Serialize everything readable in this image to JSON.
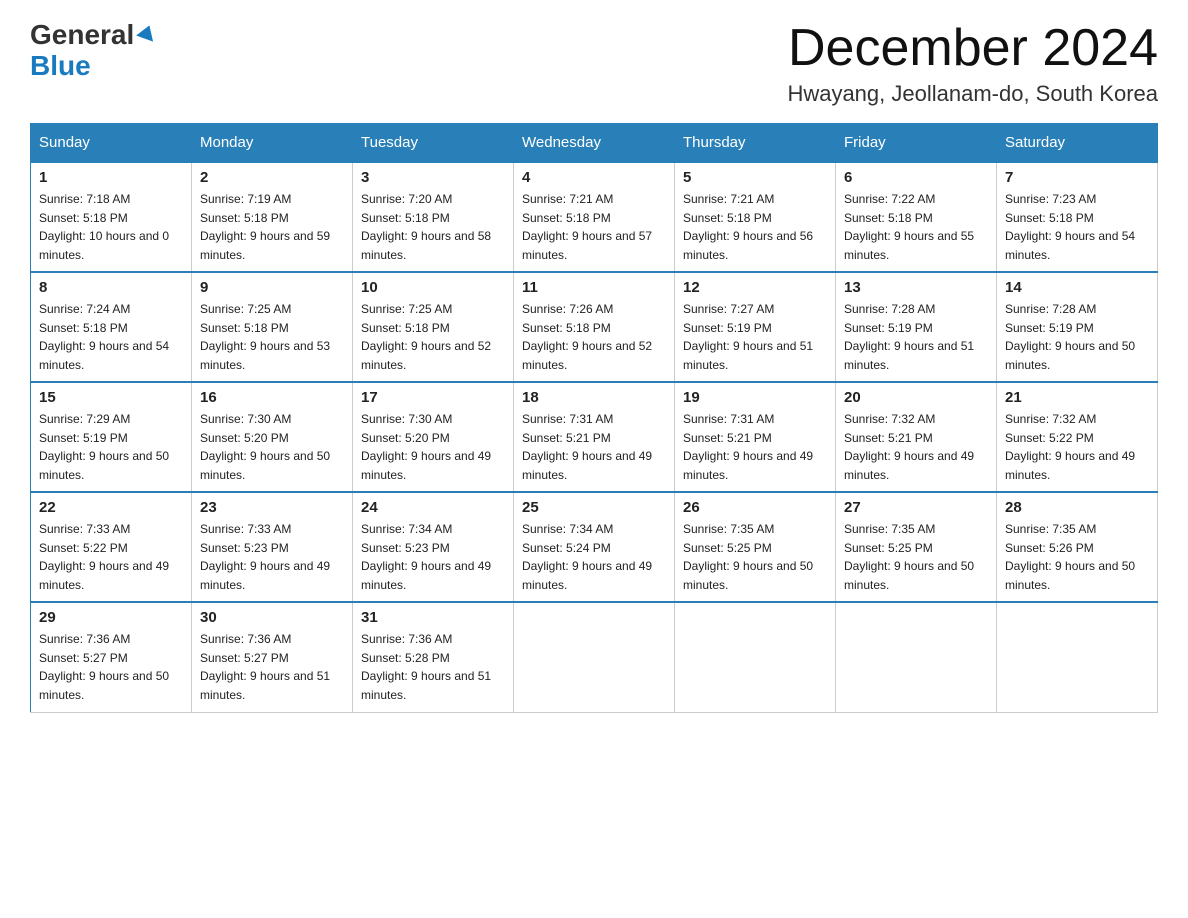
{
  "header": {
    "logo_general": "General",
    "logo_blue": "Blue",
    "month_title": "December 2024",
    "location": "Hwayang, Jeollanam-do, South Korea"
  },
  "weekdays": [
    "Sunday",
    "Monday",
    "Tuesday",
    "Wednesday",
    "Thursday",
    "Friday",
    "Saturday"
  ],
  "weeks": [
    [
      {
        "day": "1",
        "sunrise": "7:18 AM",
        "sunset": "5:18 PM",
        "daylight": "10 hours and 0 minutes."
      },
      {
        "day": "2",
        "sunrise": "7:19 AM",
        "sunset": "5:18 PM",
        "daylight": "9 hours and 59 minutes."
      },
      {
        "day": "3",
        "sunrise": "7:20 AM",
        "sunset": "5:18 PM",
        "daylight": "9 hours and 58 minutes."
      },
      {
        "day": "4",
        "sunrise": "7:21 AM",
        "sunset": "5:18 PM",
        "daylight": "9 hours and 57 minutes."
      },
      {
        "day": "5",
        "sunrise": "7:21 AM",
        "sunset": "5:18 PM",
        "daylight": "9 hours and 56 minutes."
      },
      {
        "day": "6",
        "sunrise": "7:22 AM",
        "sunset": "5:18 PM",
        "daylight": "9 hours and 55 minutes."
      },
      {
        "day": "7",
        "sunrise": "7:23 AM",
        "sunset": "5:18 PM",
        "daylight": "9 hours and 54 minutes."
      }
    ],
    [
      {
        "day": "8",
        "sunrise": "7:24 AM",
        "sunset": "5:18 PM",
        "daylight": "9 hours and 54 minutes."
      },
      {
        "day": "9",
        "sunrise": "7:25 AM",
        "sunset": "5:18 PM",
        "daylight": "9 hours and 53 minutes."
      },
      {
        "day": "10",
        "sunrise": "7:25 AM",
        "sunset": "5:18 PM",
        "daylight": "9 hours and 52 minutes."
      },
      {
        "day": "11",
        "sunrise": "7:26 AM",
        "sunset": "5:18 PM",
        "daylight": "9 hours and 52 minutes."
      },
      {
        "day": "12",
        "sunrise": "7:27 AM",
        "sunset": "5:19 PM",
        "daylight": "9 hours and 51 minutes."
      },
      {
        "day": "13",
        "sunrise": "7:28 AM",
        "sunset": "5:19 PM",
        "daylight": "9 hours and 51 minutes."
      },
      {
        "day": "14",
        "sunrise": "7:28 AM",
        "sunset": "5:19 PM",
        "daylight": "9 hours and 50 minutes."
      }
    ],
    [
      {
        "day": "15",
        "sunrise": "7:29 AM",
        "sunset": "5:19 PM",
        "daylight": "9 hours and 50 minutes."
      },
      {
        "day": "16",
        "sunrise": "7:30 AM",
        "sunset": "5:20 PM",
        "daylight": "9 hours and 50 minutes."
      },
      {
        "day": "17",
        "sunrise": "7:30 AM",
        "sunset": "5:20 PM",
        "daylight": "9 hours and 49 minutes."
      },
      {
        "day": "18",
        "sunrise": "7:31 AM",
        "sunset": "5:21 PM",
        "daylight": "9 hours and 49 minutes."
      },
      {
        "day": "19",
        "sunrise": "7:31 AM",
        "sunset": "5:21 PM",
        "daylight": "9 hours and 49 minutes."
      },
      {
        "day": "20",
        "sunrise": "7:32 AM",
        "sunset": "5:21 PM",
        "daylight": "9 hours and 49 minutes."
      },
      {
        "day": "21",
        "sunrise": "7:32 AM",
        "sunset": "5:22 PM",
        "daylight": "9 hours and 49 minutes."
      }
    ],
    [
      {
        "day": "22",
        "sunrise": "7:33 AM",
        "sunset": "5:22 PM",
        "daylight": "9 hours and 49 minutes."
      },
      {
        "day": "23",
        "sunrise": "7:33 AM",
        "sunset": "5:23 PM",
        "daylight": "9 hours and 49 minutes."
      },
      {
        "day": "24",
        "sunrise": "7:34 AM",
        "sunset": "5:23 PM",
        "daylight": "9 hours and 49 minutes."
      },
      {
        "day": "25",
        "sunrise": "7:34 AM",
        "sunset": "5:24 PM",
        "daylight": "9 hours and 49 minutes."
      },
      {
        "day": "26",
        "sunrise": "7:35 AM",
        "sunset": "5:25 PM",
        "daylight": "9 hours and 50 minutes."
      },
      {
        "day": "27",
        "sunrise": "7:35 AM",
        "sunset": "5:25 PM",
        "daylight": "9 hours and 50 minutes."
      },
      {
        "day": "28",
        "sunrise": "7:35 AM",
        "sunset": "5:26 PM",
        "daylight": "9 hours and 50 minutes."
      }
    ],
    [
      {
        "day": "29",
        "sunrise": "7:36 AM",
        "sunset": "5:27 PM",
        "daylight": "9 hours and 50 minutes."
      },
      {
        "day": "30",
        "sunrise": "7:36 AM",
        "sunset": "5:27 PM",
        "daylight": "9 hours and 51 minutes."
      },
      {
        "day": "31",
        "sunrise": "7:36 AM",
        "sunset": "5:28 PM",
        "daylight": "9 hours and 51 minutes."
      },
      null,
      null,
      null,
      null
    ]
  ]
}
